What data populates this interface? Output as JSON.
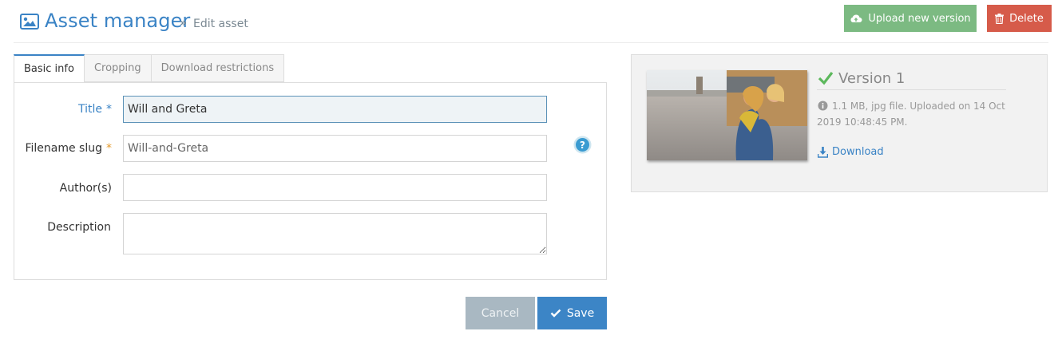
{
  "header": {
    "app_title": "Asset manager",
    "breadcrumb_separator": "»",
    "breadcrumb_current": "Edit asset",
    "upload_button": "Upload new version",
    "delete_button": "Delete",
    "colors": {
      "accent": "#3a83c5",
      "upload": "#7cba82",
      "delete": "#d65b4a"
    }
  },
  "tabs": [
    {
      "label": "Basic info",
      "active": true
    },
    {
      "label": "Cropping",
      "active": false
    },
    {
      "label": "Download restrictions",
      "active": false
    }
  ],
  "form": {
    "title": {
      "label": "Title",
      "required_mark": "*",
      "value": "Will and Greta"
    },
    "slug": {
      "label": "Filename slug",
      "required_mark": "*",
      "value": "Will-and-Greta"
    },
    "authors": {
      "label": "Author(s)",
      "value": ""
    },
    "description": {
      "label": "Description",
      "value": ""
    },
    "help_icon": "question-circle-icon"
  },
  "actions": {
    "cancel": "Cancel",
    "save": "Save"
  },
  "version": {
    "title": "Version 1",
    "info": "1.1 MB, jpg file. Uploaded on 14 Oct 2019 10:48:45 PM.",
    "download": "Download"
  }
}
